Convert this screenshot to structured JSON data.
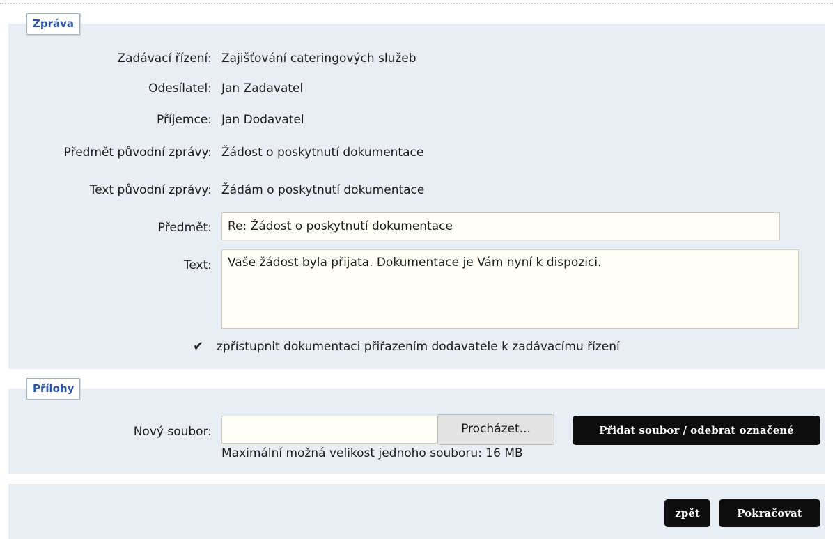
{
  "message_section": {
    "legend": "Zpráva",
    "fields": [
      {
        "label": "Zadávací řízení:",
        "value": "Zajišťování cateringových služeb"
      },
      {
        "label": "Odesílatel:",
        "value": "Jan Zadavatel"
      },
      {
        "label": "Příjemce:",
        "value": "Jan Dodavatel"
      },
      {
        "label": "Předmět původní zprávy:",
        "value": "Žádost o poskytnutí dokumentace"
      },
      {
        "label": "Text původní zprávy:",
        "value": "Žádám o poskytnutí dokumentace"
      }
    ],
    "subject_label": "Předmět:",
    "subject_value": "Re: Žádost o poskytnutí dokumentace",
    "text_label": "Text:",
    "text_value": "Vaše žádost byla přijata. Dokumentace je Vám nyní k dispozici.",
    "checkbox_checked": true,
    "checkbox_icon": "checkmark-icon",
    "checkbox_label": "zpřístupnit dokumentaci přiřazením dodavatele k zadávacímu řízení"
  },
  "attachments_section": {
    "legend": "Přílohy",
    "new_file_label": "Nový soubor:",
    "file_value": "",
    "browse_label": "Procházet...",
    "add_remove_label": "Přidat soubor / odebrat označené",
    "max_size_note": "Maximální možná velikost jednoho souboru: 16 MB"
  },
  "footer": {
    "back_label": "zpět",
    "continue_label": "Pokračovat"
  }
}
